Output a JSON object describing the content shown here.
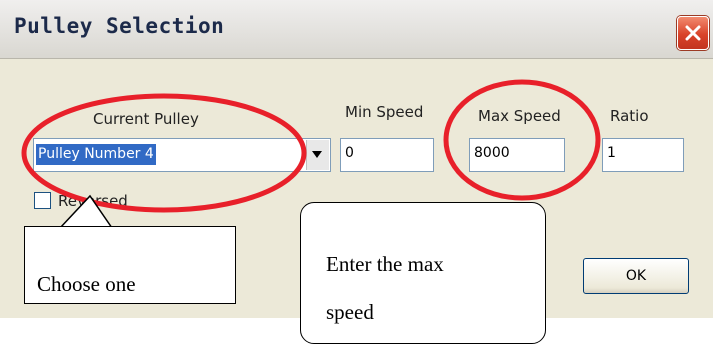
{
  "window": {
    "title": "Pulley Selection"
  },
  "labels": {
    "current_pulley": "Current Pulley",
    "min_speed": "Min Speed",
    "max_speed": "Max Speed",
    "ratio": "Ratio"
  },
  "fields": {
    "current_pulley": "Pulley Number 4",
    "min_speed": "0",
    "max_speed": "8000",
    "ratio": "1"
  },
  "checkbox": {
    "label": "Reversed",
    "checked": false
  },
  "buttons": {
    "ok": "OK"
  },
  "annotations": {
    "choose_one": "Choose one",
    "enter_max_line1": "Enter the max",
    "enter_max_line2": "speed"
  },
  "colors": {
    "annotation": "#e8202a",
    "selection": "#316ac5"
  },
  "icons": {
    "close": "close-x-icon",
    "dropdown": "chevron-down-icon"
  }
}
